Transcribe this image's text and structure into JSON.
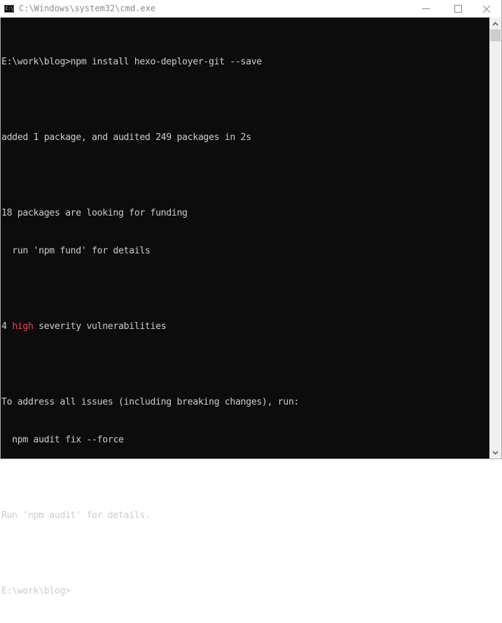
{
  "window": {
    "title": "C:\\Windows\\system32\\cmd.exe",
    "app_icon_text": "C:\\_",
    "controls": {
      "minimize": "minimize",
      "maximize": "maximize",
      "close": "close"
    }
  },
  "console": {
    "colors": {
      "background": "#0c0c0c",
      "foreground": "#cccccc",
      "highlight_red": "#e74856"
    },
    "lines": [
      {
        "text": "E:\\work\\blog>npm install hexo-deployer-git --save"
      },
      {
        "text": ""
      },
      {
        "text": "added 1 package, and audited 249 packages in 2s"
      },
      {
        "text": ""
      },
      {
        "text": "18 packages are looking for funding"
      },
      {
        "text": "  run 'npm fund' for details"
      },
      {
        "text": ""
      },
      {
        "pre": "4 ",
        "red": "high",
        "post": " severity vulnerabilities"
      },
      {
        "text": ""
      },
      {
        "text": "To address all issues (including breaking changes), run:"
      },
      {
        "text": "  npm audit fix --force"
      },
      {
        "text": ""
      },
      {
        "text": "Run 'npm audit' for details."
      },
      {
        "text": ""
      },
      {
        "text": "E:\\work\\blog>"
      }
    ]
  },
  "scrollbar": {
    "position_fraction": 0.0
  }
}
